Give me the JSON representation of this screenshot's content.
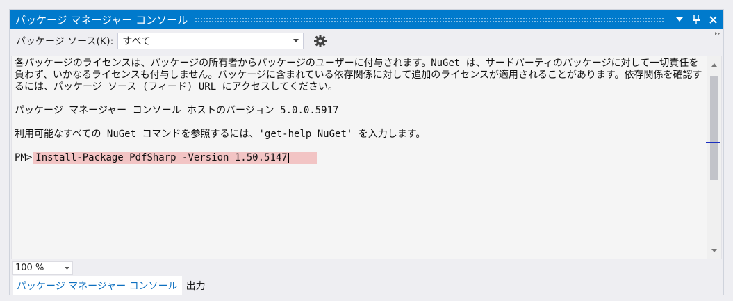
{
  "window": {
    "title": "パッケージ マネージャー コンソール",
    "dropdown_glyph": "▼",
    "pin_glyph": "📌",
    "close_glyph": "✕"
  },
  "toolbar": {
    "source_label": "パッケージ ソース(K):",
    "source_value": "すべて",
    "source_arrow": "▼",
    "overflow_glyph": "▸▸"
  },
  "console": {
    "license_text": "各パッケージのライセンスは、パッケージの所有者からパッケージのユーザーに付与されます。NuGet は、サードパーティのパッケージに対して一切責任を負わず、いかなるライセンスも付与しません。パッケージに含まれている依存関係に対して追加のライセンスが適用されることがあります。依存関係を確認するには、パッケージ ソース (フィード) URL にアクセスしてください。",
    "host_version": "パッケージ マネージャー コンソール ホストのバージョン 5.0.0.5917",
    "help_hint": "利用可能なすべての NuGet コマンドを参照するには、'get-help NuGet' を入力します。",
    "prompt": "PM>",
    "command": "Install-Package PdfSharp -Version 1.50.5147",
    "scroll_up": "▲",
    "scroll_down": "▼"
  },
  "zoom": {
    "value": "100 %",
    "arrow": "▼"
  },
  "tabs": [
    {
      "label": "パッケージ マネージャー コンソール"
    },
    {
      "label": "出力"
    }
  ],
  "colors": {
    "accent": "#007acc",
    "active_tab_text": "#0e70c0",
    "command_highlight": "#f2c4c4"
  }
}
